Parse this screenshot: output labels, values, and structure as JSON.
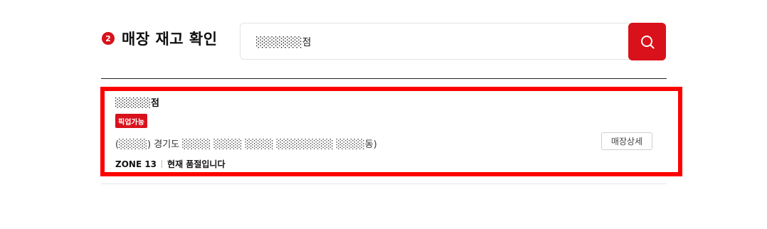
{
  "header": {
    "step_number": "2",
    "title": "매장 재고 확인"
  },
  "search": {
    "value": "░░░░░░점",
    "search_icon": "search-icon"
  },
  "result": {
    "store_name": "░░░░░점",
    "pickup_badge": "픽업가능",
    "address": "(░░░░) 경기도 ░░░░ ░░░░ ░░░░ ░░░░░░░░ ░░░░동)",
    "detail_button": "매장상세",
    "zone": "ZONE 13",
    "stock_status": "현재 품절입니다"
  },
  "colors": {
    "accent": "#d9111b",
    "highlight": "#ff0000"
  }
}
